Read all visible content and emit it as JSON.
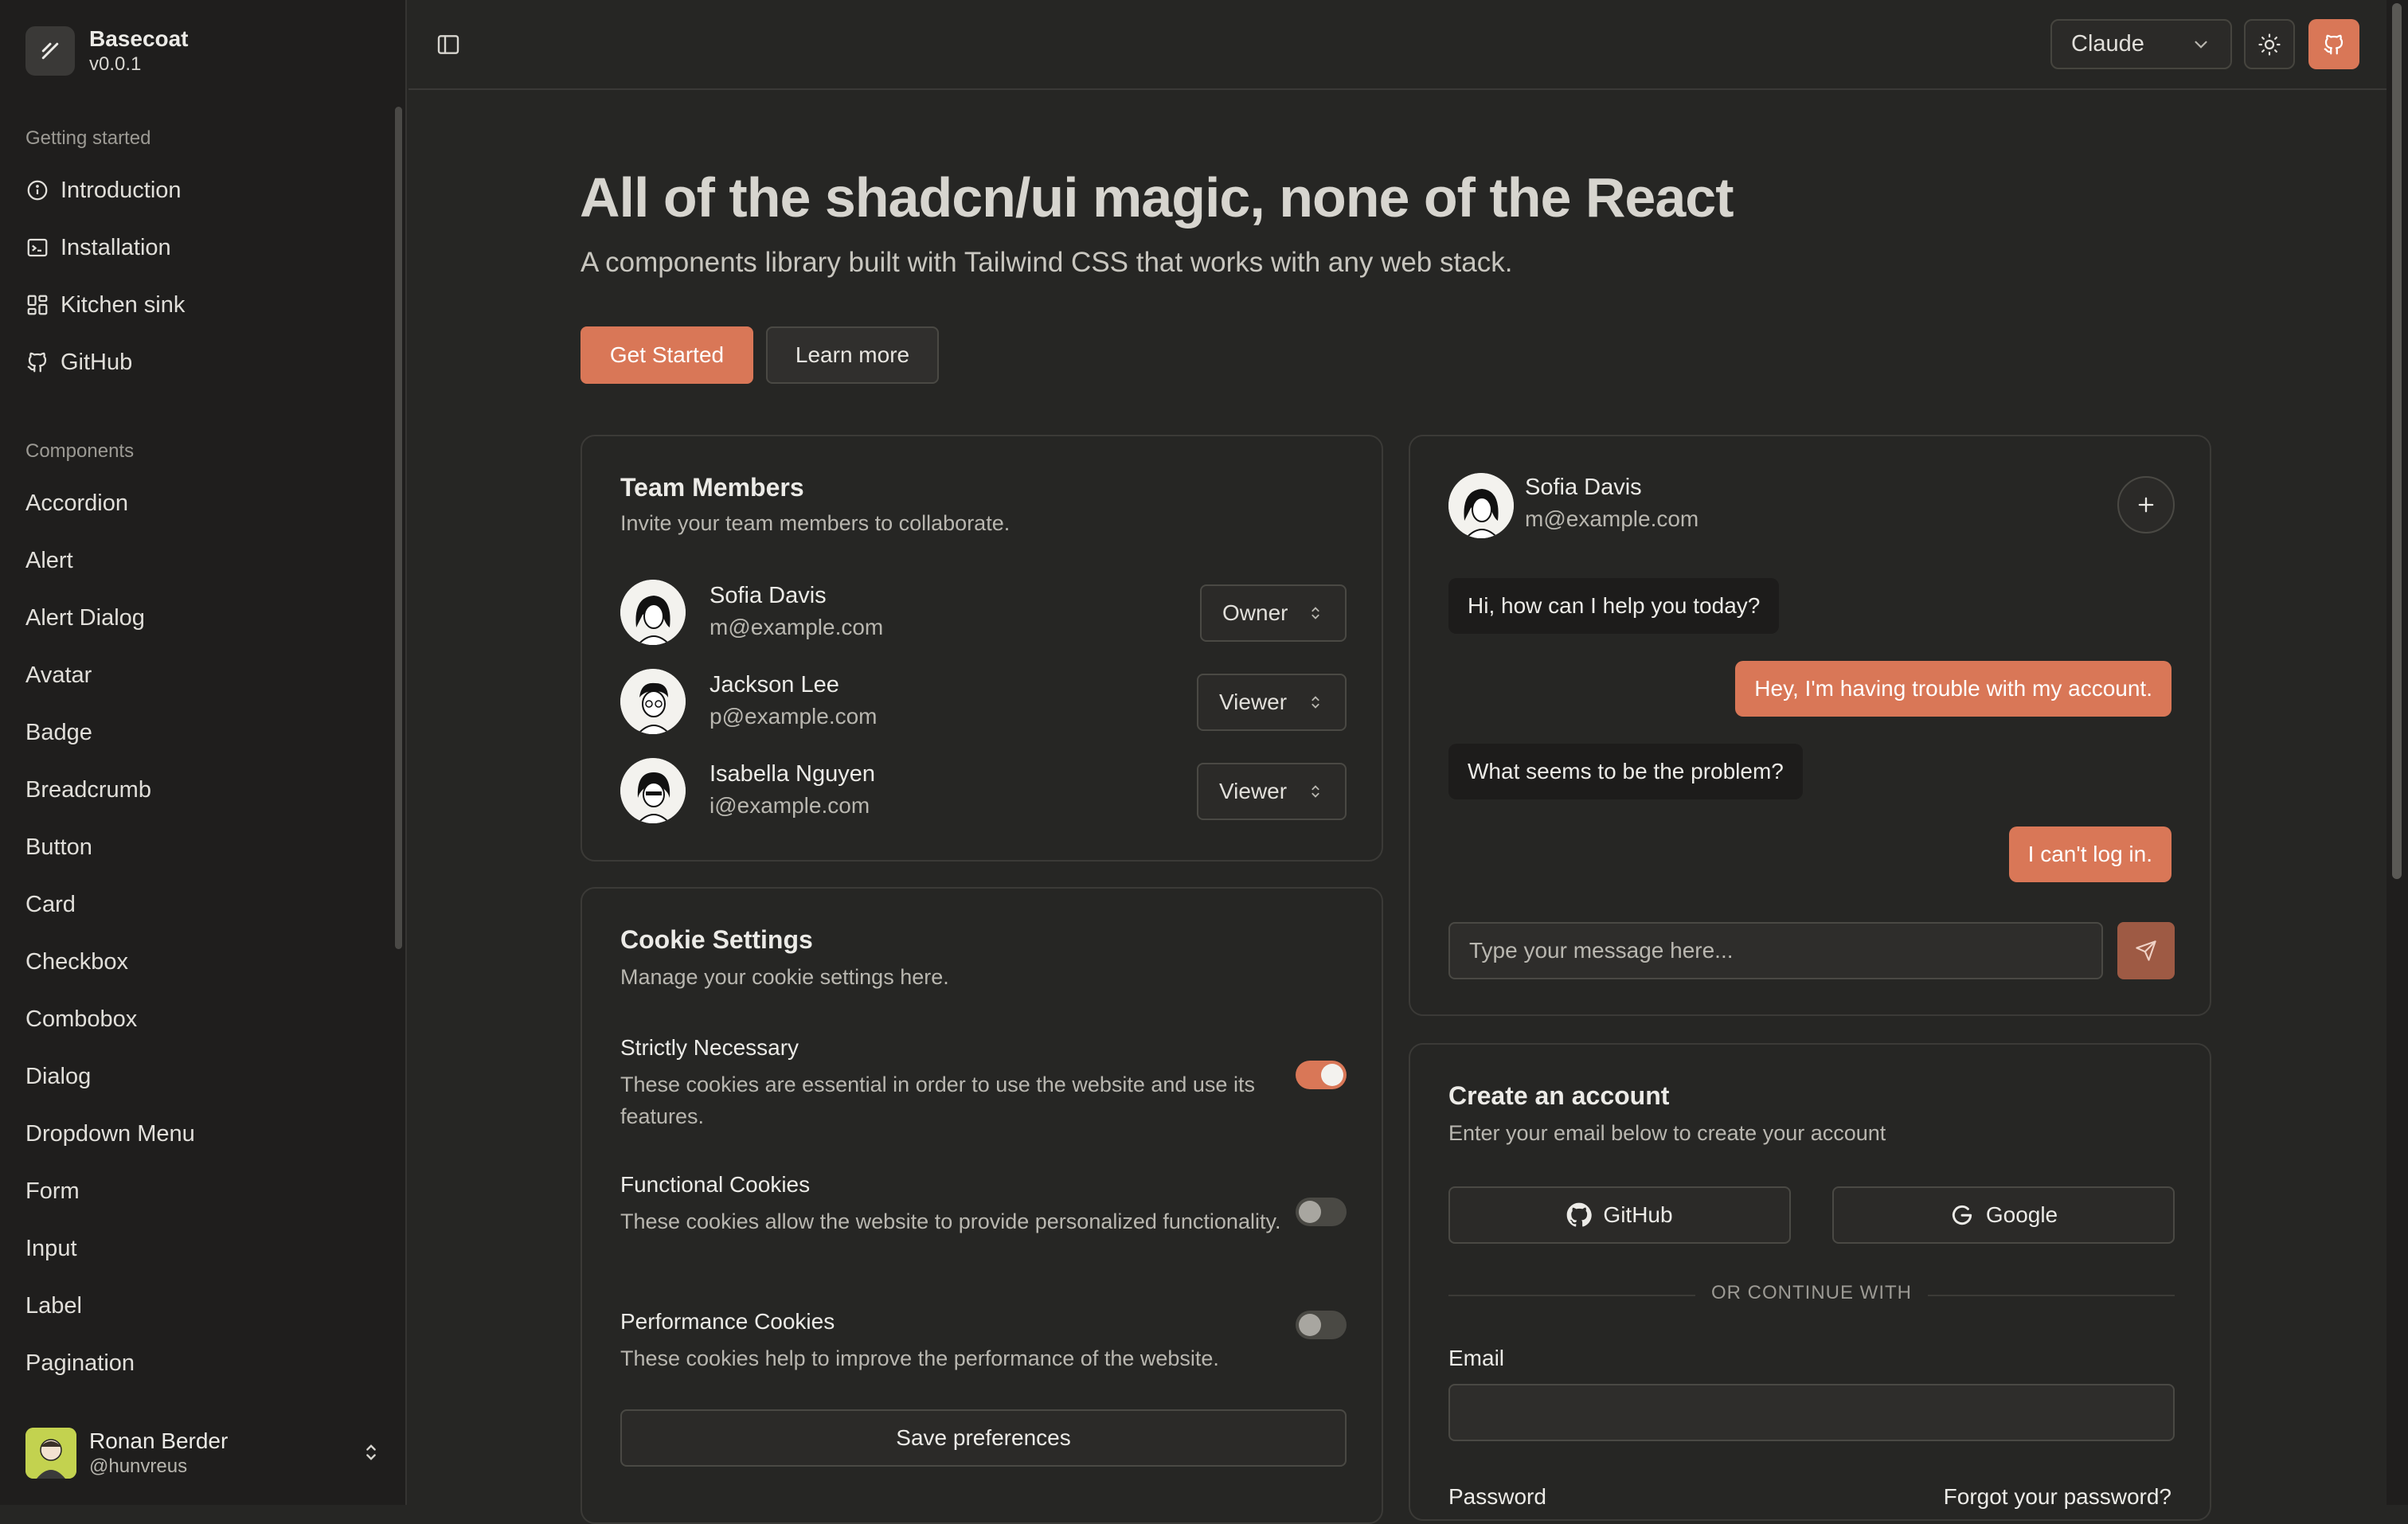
{
  "brand": {
    "name": "Basecoat",
    "version": "v0.0.1"
  },
  "sidebar": {
    "getting_started_label": "Getting started",
    "getting_started": [
      {
        "label": "Introduction",
        "icon": "info-icon"
      },
      {
        "label": "Installation",
        "icon": "terminal-icon"
      },
      {
        "label": "Kitchen sink",
        "icon": "grid-icon"
      },
      {
        "label": "GitHub",
        "icon": "github-icon"
      }
    ],
    "components_label": "Components",
    "components": [
      "Accordion",
      "Alert",
      "Alert Dialog",
      "Avatar",
      "Badge",
      "Breadcrumb",
      "Button",
      "Card",
      "Checkbox",
      "Combobox",
      "Dialog",
      "Dropdown Menu",
      "Form",
      "Input",
      "Label",
      "Pagination"
    ],
    "user": {
      "name": "Ronan Berder",
      "handle": "@hunvreus"
    }
  },
  "header": {
    "theme_value": "Claude"
  },
  "hero": {
    "title": "All of the shadcn/ui magic, none of the React",
    "subtitle": "A components library built with Tailwind CSS that works with any web stack.",
    "primary_label": "Get Started",
    "secondary_label": "Learn more"
  },
  "team": {
    "title": "Team Members",
    "description": "Invite your team members to collaborate.",
    "members": [
      {
        "name": "Sofia Davis",
        "email": "m@example.com",
        "role": "Owner"
      },
      {
        "name": "Jackson Lee",
        "email": "p@example.com",
        "role": "Viewer"
      },
      {
        "name": "Isabella Nguyen",
        "email": "i@example.com",
        "role": "Viewer"
      }
    ]
  },
  "cookies": {
    "title": "Cookie Settings",
    "description": "Manage your cookie settings here.",
    "items": [
      {
        "name": "Strictly Necessary",
        "desc": "These cookies are essential in order to use the website and use its features.",
        "enabled": true
      },
      {
        "name": "Functional Cookies",
        "desc": "These cookies allow the website to provide personalized functionality.",
        "enabled": false
      },
      {
        "name": "Performance Cookies",
        "desc": "These cookies help to improve the performance of the website.",
        "enabled": false
      }
    ],
    "save_label": "Save preferences"
  },
  "chat": {
    "contact_name": "Sofia Davis",
    "contact_email": "m@example.com",
    "messages": [
      {
        "text": "Hi, how can I help you today?",
        "from": "agent"
      },
      {
        "text": "Hey, I'm having trouble with my account.",
        "from": "user"
      },
      {
        "text": "What seems to be the problem?",
        "from": "agent"
      },
      {
        "text": "I can't log in.",
        "from": "user"
      }
    ],
    "input_placeholder": "Type your message here..."
  },
  "account": {
    "title": "Create an account",
    "description": "Enter your email below to create your account",
    "github_label": "GitHub",
    "google_label": "Google",
    "divider": "OR CONTINUE WITH",
    "email_label": "Email",
    "password_label": "Password",
    "forgot_label": "Forgot your password?"
  },
  "colors": {
    "accent": "#d97757",
    "background": "#262624",
    "sidebar": "#1f1e1d"
  }
}
